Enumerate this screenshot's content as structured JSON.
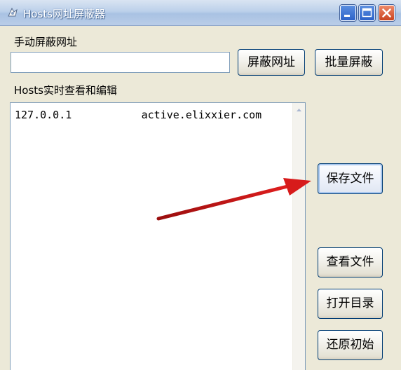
{
  "window": {
    "title": "Hosts网址屏蔽器",
    "icon": "app-icon",
    "controls": [
      "minimize-icon",
      "maximize-icon",
      "close-icon"
    ]
  },
  "manual_block": {
    "label": "手动屏蔽网址",
    "input_value": "",
    "block_button": "屏蔽网址",
    "batch_button": "批量屏蔽"
  },
  "hosts_editor": {
    "label": "Hosts实时查看和编辑",
    "content": "127.0.0.1           active.elixxier.com"
  },
  "actions": {
    "save": "保存文件",
    "view": "查看文件",
    "open_dir": "打开目录",
    "restore": "还原初始"
  },
  "annotation": {
    "arrow_color": "#d11a1a",
    "points_to": "save-file-button"
  },
  "colors": {
    "window_bg": "#ece9d8",
    "button_border": "#003c74",
    "input_border": "#7f9db9"
  }
}
